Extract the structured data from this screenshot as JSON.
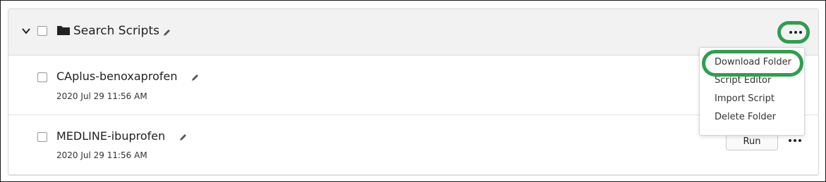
{
  "folder": {
    "name": "Search Scripts",
    "icons": {
      "toggle": "chevron-down-icon",
      "folder": "folder-icon",
      "edit": "pencil-icon",
      "more": "ellipsis-icon"
    }
  },
  "scripts": [
    {
      "name": "CAplus-benoxaprofen",
      "date": "2020 Jul 29 11:56 AM"
    },
    {
      "name": "MEDLINE-ibuprofen",
      "date": "2020 Jul 29 11:56 AM",
      "run_label": "Run"
    }
  ],
  "menu": {
    "items": [
      "Download Folder",
      "Script Editor",
      "Import Script",
      "Delete Folder"
    ]
  },
  "colors": {
    "highlight": "#2f9e4f",
    "header_bg": "#f2f2f2"
  }
}
